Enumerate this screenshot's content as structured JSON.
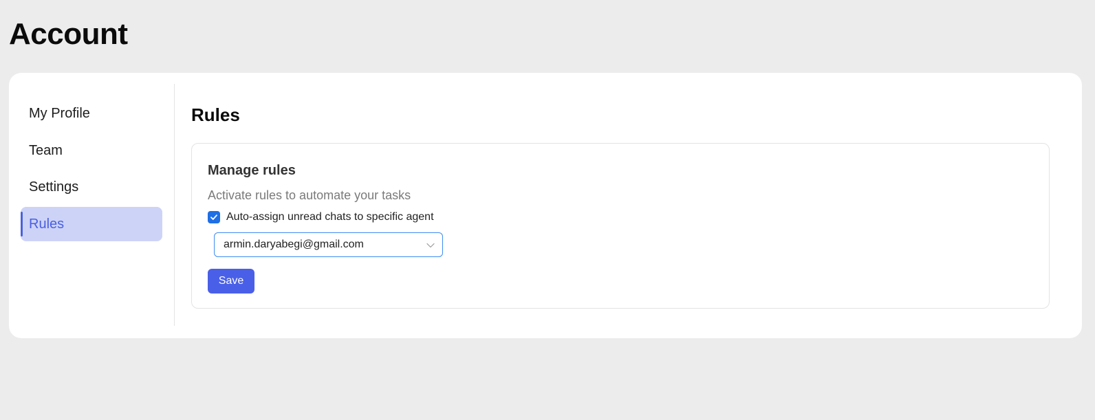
{
  "page": {
    "title": "Account"
  },
  "sidebar": {
    "items": [
      {
        "label": "My Profile",
        "active": false
      },
      {
        "label": "Team",
        "active": false
      },
      {
        "label": "Settings",
        "active": false
      },
      {
        "label": "Rules",
        "active": true
      }
    ]
  },
  "main": {
    "title": "Rules",
    "panel": {
      "heading": "Manage rules",
      "subtitle": "Activate rules to automate your tasks",
      "rule": {
        "label": "Auto-assign unread chats to specific agent",
        "checked": true
      },
      "agent_select": {
        "value": "armin.daryabegi@gmail.com",
        "icon": "chevron-down-icon"
      },
      "save_label": "Save"
    }
  },
  "colors": {
    "background": "#ececec",
    "card": "#ffffff",
    "accent": "#4a5fe8",
    "active_nav_bg": "#cdd3f7",
    "checkbox": "#1f6fe5",
    "select_border": "#3d8bf2"
  }
}
